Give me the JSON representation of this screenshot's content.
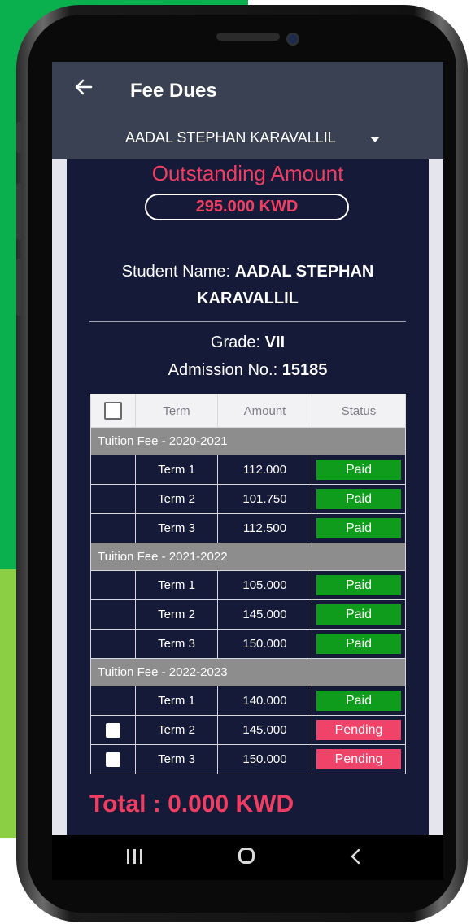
{
  "header": {
    "title": "Fee Dues",
    "student_selector": "AADAL STEPHAN KARAVALLIL"
  },
  "summary": {
    "outstanding_label": "Outstanding Amount",
    "outstanding_value": "295.000 KWD",
    "student_name_label": "Student Name:",
    "student_name": "AADAL STEPHAN KARAVALLIL",
    "grade_label": "Grade:",
    "grade": "VII",
    "admission_label": "Admission No.:",
    "admission_no": "15185"
  },
  "table": {
    "columns": [
      "",
      "Term",
      "Amount",
      "Status"
    ],
    "groups": [
      {
        "title": "Tuition Fee - 2020-2021",
        "rows": [
          {
            "term": "Term 1",
            "amount": "112.000",
            "status": "Paid"
          },
          {
            "term": "Term 2",
            "amount": "101.750",
            "status": "Paid"
          },
          {
            "term": "Term 3",
            "amount": "112.500",
            "status": "Paid"
          }
        ]
      },
      {
        "title": "Tuition Fee - 2021-2022",
        "rows": [
          {
            "term": "Term 1",
            "amount": "105.000",
            "status": "Paid"
          },
          {
            "term": "Term 2",
            "amount": "145.000",
            "status": "Paid"
          },
          {
            "term": "Term 3",
            "amount": "150.000",
            "status": "Paid"
          }
        ]
      },
      {
        "title": "Tuition Fee - 2022-2023",
        "rows": [
          {
            "term": "Term 1",
            "amount": "140.000",
            "status": "Paid"
          },
          {
            "term": "Term 2",
            "amount": "145.000",
            "status": "Pending"
          },
          {
            "term": "Term 3",
            "amount": "150.000",
            "status": "Pending"
          }
        ]
      }
    ]
  },
  "footer": {
    "total": "Total : 0.000 KWD"
  },
  "colors": {
    "accent": "#ee3f62",
    "paid": "#0f9b1b",
    "pending": "#f0436a",
    "background": "#141a38",
    "appbar": "#394152"
  },
  "icons": {
    "back": "arrow-left-icon",
    "dropdown": "caret-down-icon",
    "nav_recent": "recent-apps-icon",
    "nav_home": "home-icon",
    "nav_back": "chevron-left-icon"
  }
}
